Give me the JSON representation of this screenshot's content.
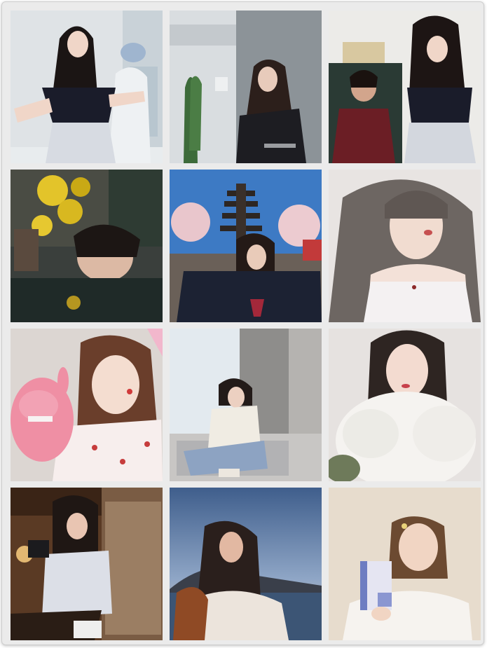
{
  "collage": {
    "columns": 3,
    "rows": 4,
    "photos": [
      {
        "subject": "portrait-off-shoulder-dark-top-with-mannequin"
      },
      {
        "subject": "portrait-dark-blazer-with-cactus"
      },
      {
        "subject": "portrait-off-shoulder-with-painting"
      },
      {
        "subject": "portrait-yellow-flowers-reflection"
      },
      {
        "subject": "portrait-pagoda-blue-sky"
      },
      {
        "subject": "portrait-white-camisole-close-up"
      },
      {
        "subject": "portrait-pink-plush-toy-heart-pajamas"
      },
      {
        "subject": "portrait-sitting-by-window-curtains"
      },
      {
        "subject": "portrait-white-fluffy-sweater"
      },
      {
        "subject": "portrait-holding-camera-indoors"
      },
      {
        "subject": "portrait-harbour-bridge-sunset"
      },
      {
        "subject": "portrait-holding-blue-box-beige-wall"
      }
    ]
  },
  "colors": {
    "frame_background": "#ebebeb",
    "frame_border": "#cfcfcf"
  }
}
